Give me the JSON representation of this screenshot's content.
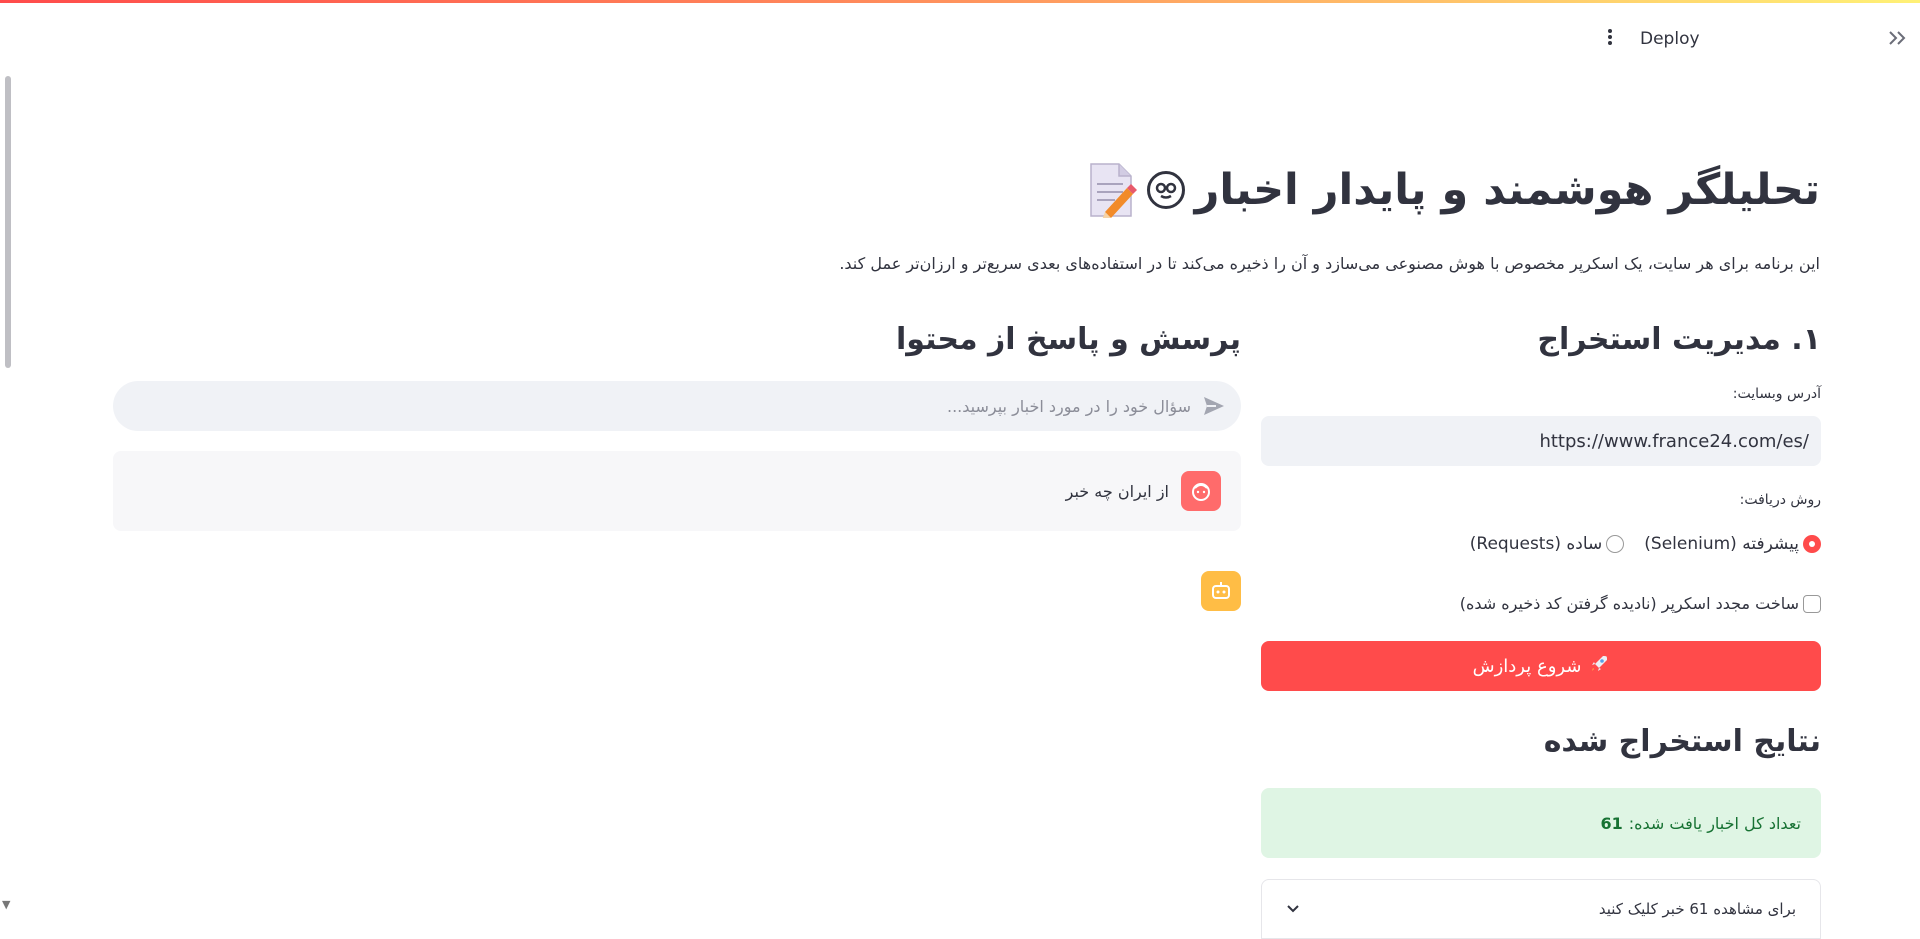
{
  "header": {
    "deploy_label": "Deploy",
    "menu_icon": "vertical-ellipsis-icon",
    "collapse_icon": "double-chevron-right-icon"
  },
  "colors": {
    "accent": "#ff4b4b",
    "success_bg": "#dff5e4",
    "success_text": "#177233",
    "input_bg": "#f0f2f6",
    "bot_avatar": "#ffbd45",
    "user_avatar": "#ff6b6b"
  },
  "page": {
    "title": "تحلیلگر هوشمند و پایدار اخبار",
    "subtitle": "این برنامه برای هر سایت، یک اسکرپر مخصوص با هوش مصنوعی می‌سازد و آن را ذخیره می‌کند تا در استفاده‌های بعدی سریع‌تر و ارزان‌تر عمل کند."
  },
  "extraction": {
    "heading": "۱. مدیریت استخراج",
    "url_label": "آدرس وبسایت:",
    "url_value": "https://www.france24.com/es/",
    "method_label": "روش دریافت:",
    "methods": [
      {
        "label": "پیشرفته (Selenium)",
        "selected": true
      },
      {
        "label": "ساده (Requests)",
        "selected": false
      }
    ],
    "rebuild_label": "ساخت مجدد اسکرپر (نادیده گرفتن کد ذخیره شده)",
    "rebuild_checked": false,
    "start_button": "شروع پردازش"
  },
  "results": {
    "heading": "نتایج استخراج شده",
    "count_text": "تعداد کل اخبار یافت شده:",
    "count_value": "61",
    "expander_label": "برای مشاهده 61 خبر کلیک کنید"
  },
  "qa": {
    "heading": "پرسش و پاسخ از محتوا",
    "chat_placeholder": "سؤال خود را در مورد اخبار بپرسید...",
    "messages": [
      {
        "role": "user",
        "text": "از ایران چه خبر"
      },
      {
        "role": "assistant",
        "text": ""
      }
    ]
  }
}
